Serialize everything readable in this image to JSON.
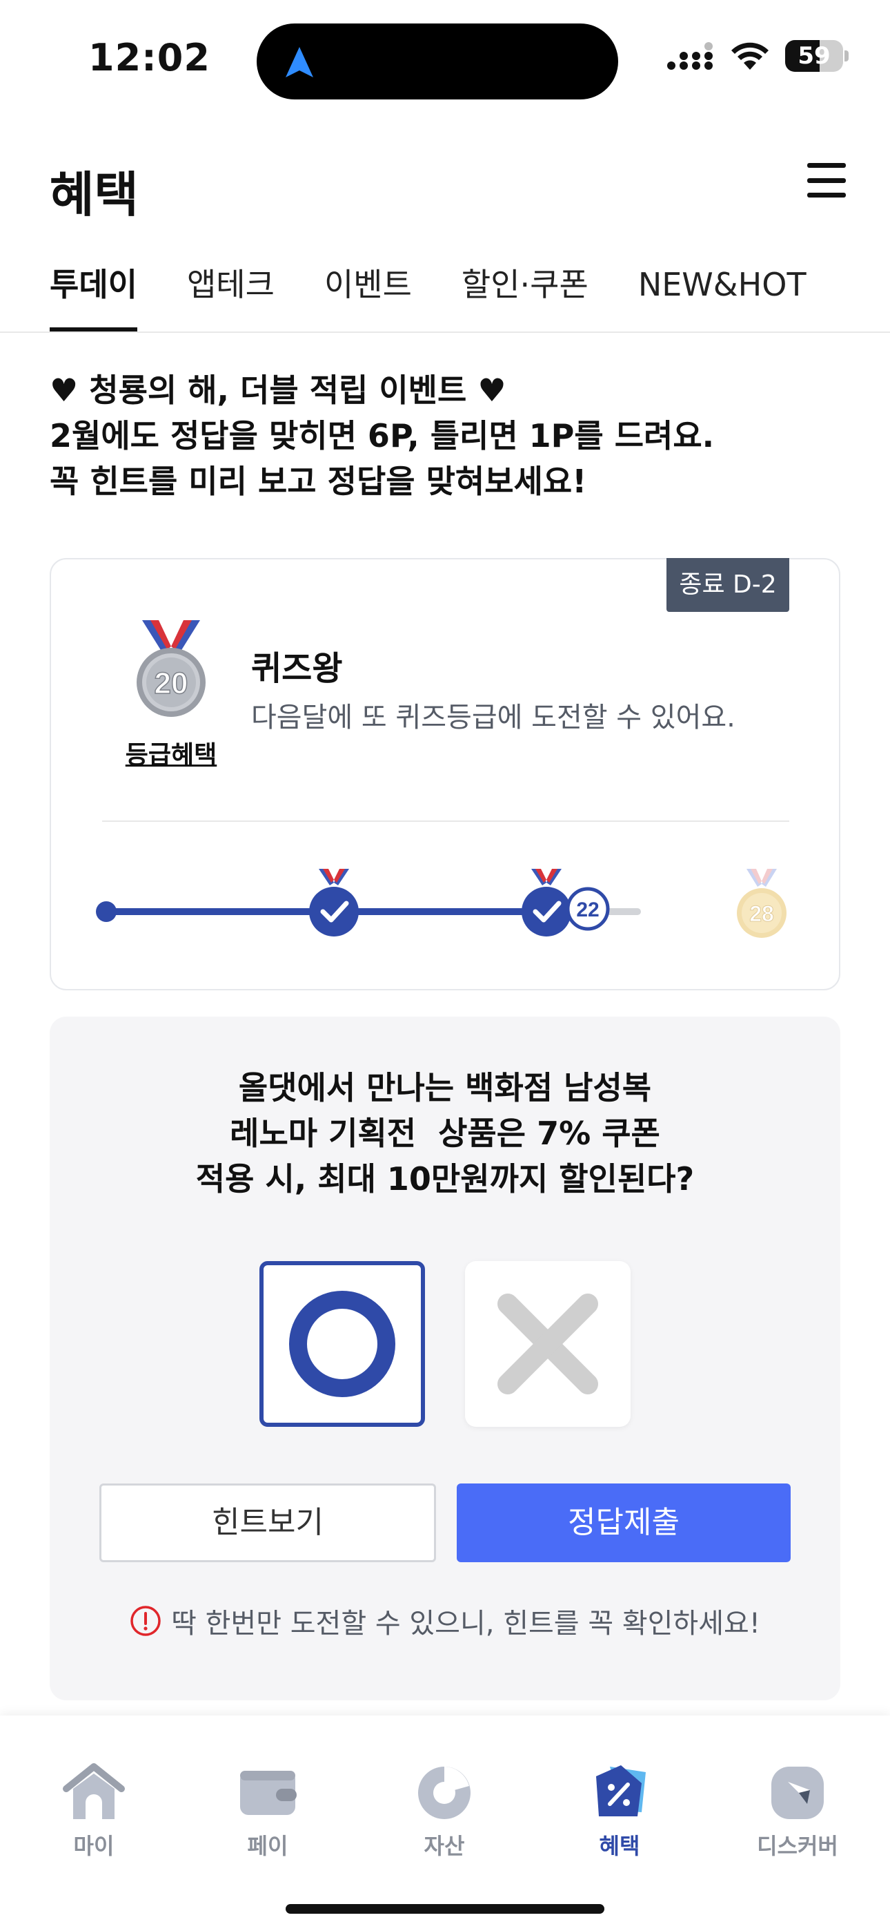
{
  "status_bar": {
    "time": "12:02",
    "battery": "59",
    "battery_level": 0.59
  },
  "header": {
    "title": "혜택"
  },
  "tabs": [
    {
      "label": "투데이",
      "active": true
    },
    {
      "label": "앱테크",
      "active": false
    },
    {
      "label": "이벤트",
      "active": false
    },
    {
      "label": "할인·쿠폰",
      "active": false
    },
    {
      "label": "NEW&HOT",
      "active": false
    }
  ],
  "intro": {
    "line1": "♥ 청룡의 해, 더블 적립 이벤트 ♥",
    "line2": "2월에도 정답을 맞히면 6P, 틀리면 1P를 드려요.",
    "line3": "꼭 힌트를 미리 보고 정답을 맞혀보세요!"
  },
  "grade_card": {
    "end_badge": "종료 D-2",
    "medal_number": "20",
    "benefit_link": "등급혜택",
    "grade_name": "퀴즈왕",
    "grade_desc": "다음달에 또 퀴즈등급에 도전할 수 있어요.",
    "progress": {
      "current_label": "22",
      "goal_label": "28",
      "completed_checkpoints": 2
    }
  },
  "quiz": {
    "question_line1": "올댓에서 만나는 백화점 남성복",
    "question_line2": "레노마 기획전  상품은 7% 쿠폰",
    "question_line3": "적용 시, 최대 10만원까지 할인된다?",
    "selected_answer": "O",
    "hint_button": "힌트보기",
    "submit_button": "정답제출",
    "warning": "딱 한번만 도전할 수 있으니, 힌트를 꼭 확인하세요!"
  },
  "bottom_nav": [
    {
      "label": "마이",
      "icon": "home-icon",
      "active": false
    },
    {
      "label": "페이",
      "icon": "wallet-icon",
      "active": false
    },
    {
      "label": "자산",
      "icon": "pie-chart-icon",
      "active": false
    },
    {
      "label": "혜택",
      "icon": "benefit-tag-icon",
      "active": true
    },
    {
      "label": "디스커버",
      "icon": "compass-icon",
      "active": false
    }
  ],
  "colors": {
    "accent": "#2f4aa8",
    "submit": "#4a6cf7",
    "badge": "#4a5568",
    "warning_red": "#e0262b"
  }
}
